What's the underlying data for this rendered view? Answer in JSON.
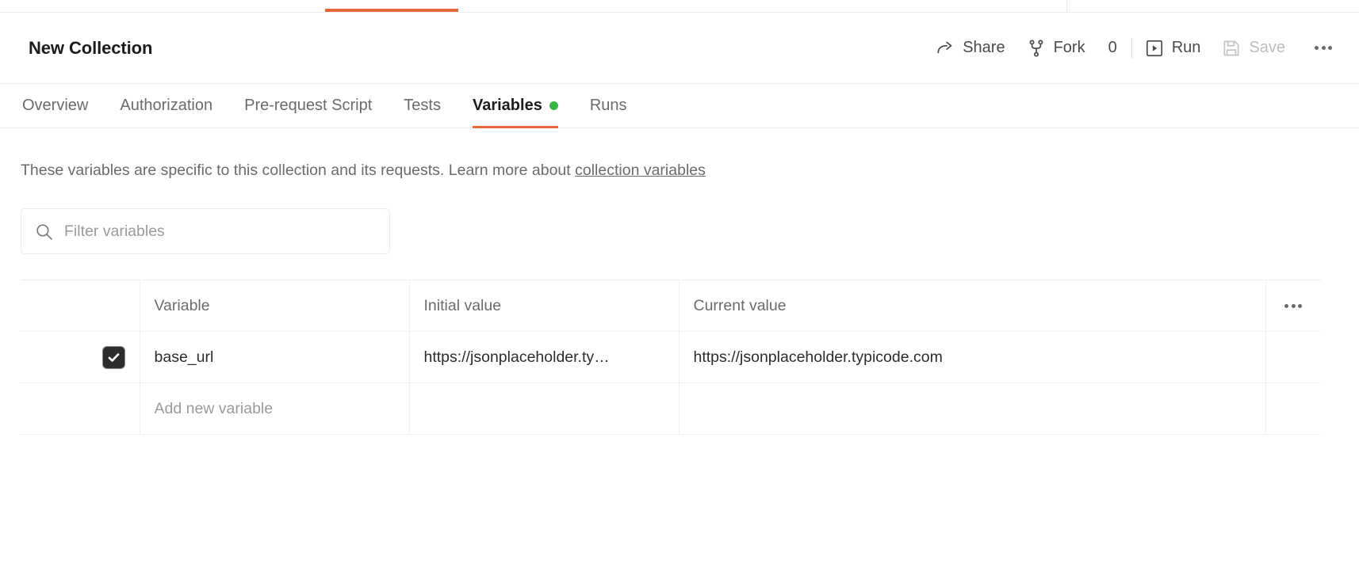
{
  "window": {
    "tab_indicator_color": "#e8683c",
    "accent_color": "#e8683c",
    "unsaved_dot_color": "#3bb54a"
  },
  "header": {
    "title": "New Collection",
    "actions": [
      {
        "label": "Share",
        "icon": "share-arrow-icon",
        "disabled": false
      },
      {
        "label": "Fork",
        "icon": "fork-branch-icon",
        "disabled": false
      },
      {
        "label": "Run",
        "icon": "play-run-icon",
        "disabled": false
      },
      {
        "label": "Save",
        "icon": "floppy-save-icon",
        "disabled": true
      }
    ],
    "share_label": "Share",
    "fork_label": "Fork",
    "fork_count": "0",
    "run_label": "Run",
    "save_label": "Save",
    "more_icon": "more-horizontal-icon"
  },
  "tabs": [
    {
      "label": "Overview",
      "active": false,
      "dot": false
    },
    {
      "label": "Authorization",
      "active": false,
      "dot": false
    },
    {
      "label": "Pre-request Script",
      "active": false,
      "dot": false
    },
    {
      "label": "Tests",
      "active": false,
      "dot": false
    },
    {
      "label": "Variables",
      "active": true,
      "dot": true
    },
    {
      "label": "Runs",
      "active": false,
      "dot": false
    }
  ],
  "description": {
    "text_before": "These variables are specific to this collection and its requests. Learn more about ",
    "link_text": "collection variables"
  },
  "search": {
    "placeholder": "Filter variables",
    "value": "",
    "icon": "search-icon"
  },
  "table": {
    "headers": {
      "variable": "Variable",
      "initial_value": "Initial value",
      "current_value": "Current value",
      "more_icon": "more-horizontal-icon"
    },
    "rows": [
      {
        "checked": true,
        "variable": "base_url",
        "initial_value": "https://jsonplaceholder.ty…",
        "current_value": "https://jsonplaceholder.typicode.com"
      }
    ],
    "add_row_placeholder": "Add new variable"
  }
}
